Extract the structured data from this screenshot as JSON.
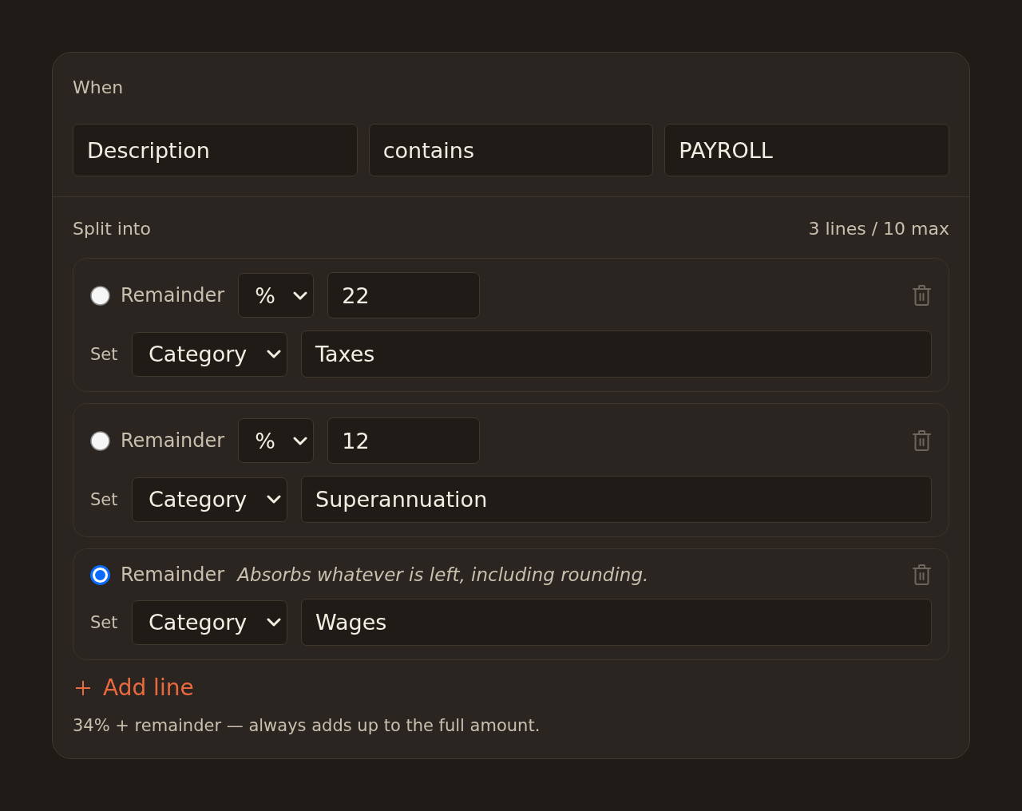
{
  "condition": {
    "label": "When",
    "field": "Description",
    "operator": "contains",
    "value": "PAYROLL"
  },
  "split": {
    "label": "Split into",
    "count": "3 lines / 10 max",
    "lines": [
      {
        "remainder": {
          "label": "Remainder",
          "selected": false
        },
        "unit": "%",
        "amount": "22",
        "set_label": "Set",
        "target": "Category",
        "value": "Taxes"
      },
      {
        "remainder": {
          "label": "Remainder",
          "selected": false
        },
        "unit": "%",
        "amount": "12",
        "set_label": "Set",
        "target": "Category",
        "value": "Superannuation"
      },
      {
        "remainder": {
          "label": "Remainder",
          "selected": true
        },
        "note": "Absorbs whatever is left, including rounding.",
        "set_label": "Set",
        "target": "Category",
        "value": "Wages"
      }
    ]
  },
  "add_button": {
    "label": "Add line"
  },
  "summary": "34% + remainder — always adds up to the full amount."
}
